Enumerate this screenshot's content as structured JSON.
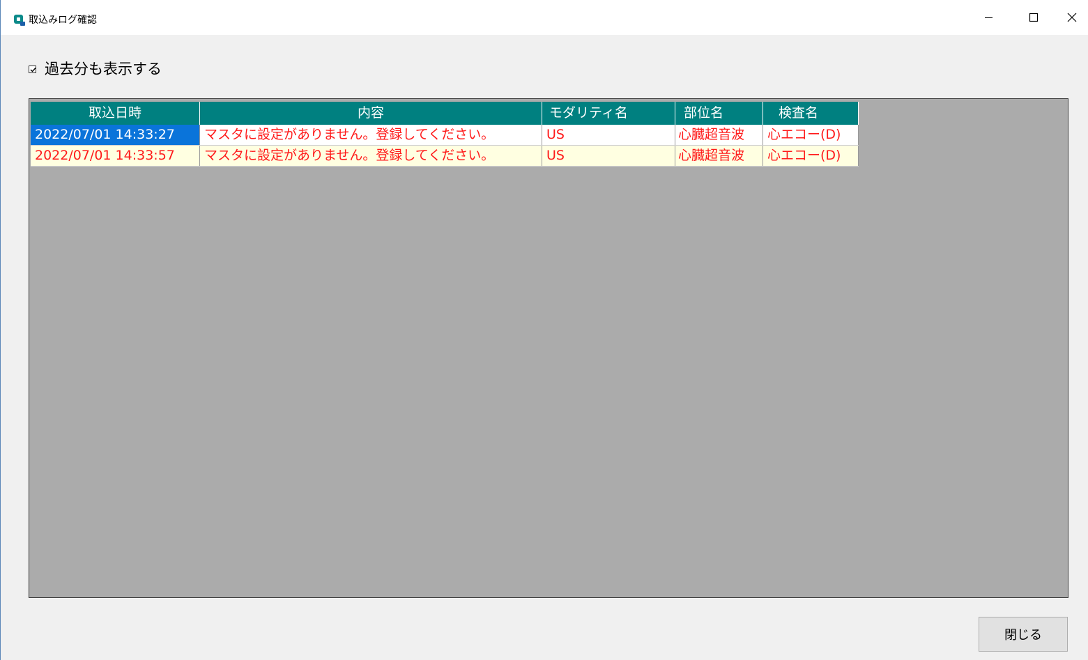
{
  "window": {
    "title": "取込みログ確認",
    "icon": "app-logo-icon",
    "controls": {
      "minimize": "minimize-icon",
      "maximize": "maximize-icon",
      "close": "close-icon"
    }
  },
  "options": {
    "show_past_label": "過去分も表示する",
    "show_past_checked": true
  },
  "table": {
    "columns": [
      "取込日時",
      "内容",
      "モダリティ名",
      "部位名",
      "検査名"
    ],
    "rows": [
      [
        "2022/07/01 14:33:27",
        "マスタに設定がありません。登録してください。",
        "US",
        "心臓超音波",
        "心エコー(D)"
      ],
      [
        "2022/07/01 14:33:57",
        "マスタに設定がありません。登録してください。",
        "US",
        "心臓超音波",
        "心エコー(D)"
      ]
    ]
  },
  "footer": {
    "close_label": "閉じる"
  },
  "colors": {
    "header_bg": "#008080",
    "error_text": "#ff1a1a",
    "selection": "#0a74da",
    "grid_bg": "#ababab",
    "alt_row": "#ffffe1"
  }
}
